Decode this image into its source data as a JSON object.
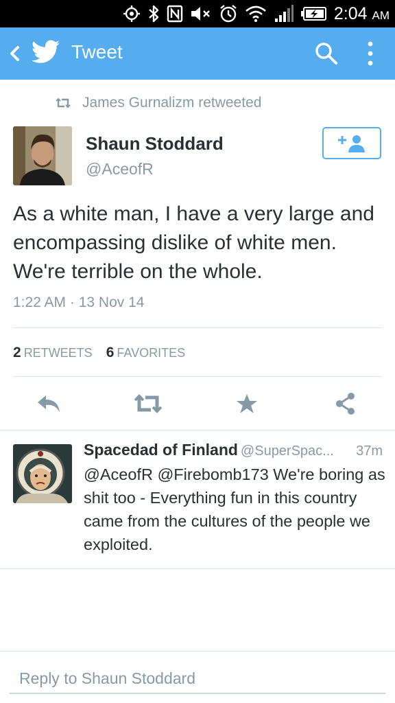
{
  "status_bar": {
    "time": "2:04",
    "ampm": "AM",
    "icons": [
      "gps-icon",
      "bluetooth-icon",
      "nfc-icon",
      "mute-icon",
      "alarm-icon",
      "wifi-icon",
      "signal-icon",
      "battery-charging-icon"
    ]
  },
  "app_bar": {
    "title": "Tweet",
    "icons": [
      "back-icon",
      "twitter-bird-icon",
      "search-icon",
      "overflow-menu-icon"
    ],
    "background": "#55acee"
  },
  "retweet": {
    "text": "James Gurnalizm retweeted"
  },
  "tweet": {
    "author_name": "Shaun Stoddard",
    "author_handle": "@AceofR",
    "text": "As a white man, I have a very large and encompassing dislike of white men. We're terrible on the whole.",
    "timestamp": "1:22 AM · 13 Nov 14",
    "retweets_count": "2",
    "retweets_label": "RETWEETS",
    "favorites_count": "6",
    "favorites_label": "FAVORITES",
    "actions": [
      "reply-icon",
      "retweet-icon",
      "favorite-icon",
      "share-icon"
    ]
  },
  "reply": {
    "name": "Spacedad of Finland",
    "handle": "@SuperSpac...",
    "time_ago": "37m",
    "text": "@AceofR @Firebomb173 We're boring as shit too - Everything fun in this country came from the cultures of the people we exploited."
  },
  "compose": {
    "placeholder": "Reply to Shaun Stoddard"
  },
  "colors": {
    "twitter_blue": "#55acee",
    "muted_text": "#8899a6",
    "primary_text": "#292f33",
    "divider": "#e1e8ed"
  }
}
